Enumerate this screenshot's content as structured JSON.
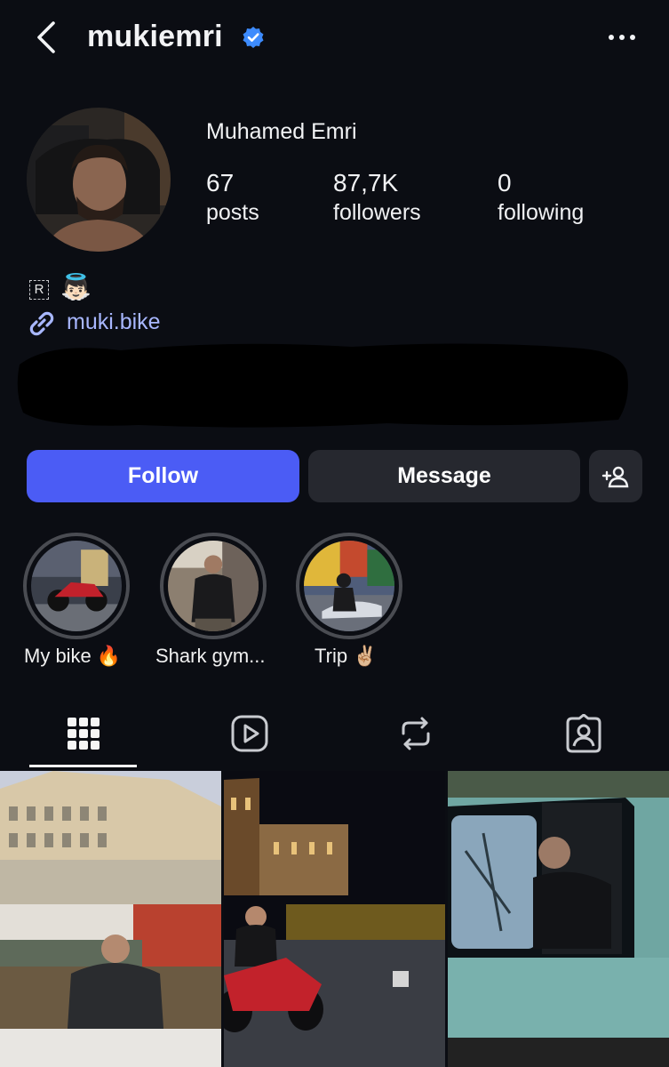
{
  "header": {
    "username": "mukiemri",
    "back_icon": "chevron-left-icon",
    "verified_icon": "verified-badge-icon",
    "more_icon": "ellipsis-icon"
  },
  "profile": {
    "full_name": "Muhamed Emri",
    "stats": [
      {
        "value": "67",
        "label": "posts"
      },
      {
        "value": "87,7K",
        "label": "followers"
      },
      {
        "value": "0",
        "label": "following"
      }
    ],
    "bio_badge": "R",
    "bio_emoji": "👼🏻",
    "link": "muki.bike"
  },
  "actions": {
    "follow_label": "Follow",
    "message_label": "Message",
    "suggest_icon": "add-person-icon"
  },
  "highlights": [
    {
      "label": "My bike 🔥"
    },
    {
      "label": "Shark gym..."
    },
    {
      "label": "Trip ✌🏼"
    }
  ],
  "tabs": [
    {
      "name": "grid-icon",
      "active": true
    },
    {
      "name": "reels-icon",
      "active": false
    },
    {
      "name": "reposts-icon",
      "active": false
    },
    {
      "name": "tagged-icon",
      "active": false
    }
  ],
  "colors": {
    "background": "#0b0d13",
    "follow_button": "#4b5cf5",
    "secondary_button": "#26282f",
    "link": "#a8b7ff",
    "verified": "#3d8bfd"
  }
}
